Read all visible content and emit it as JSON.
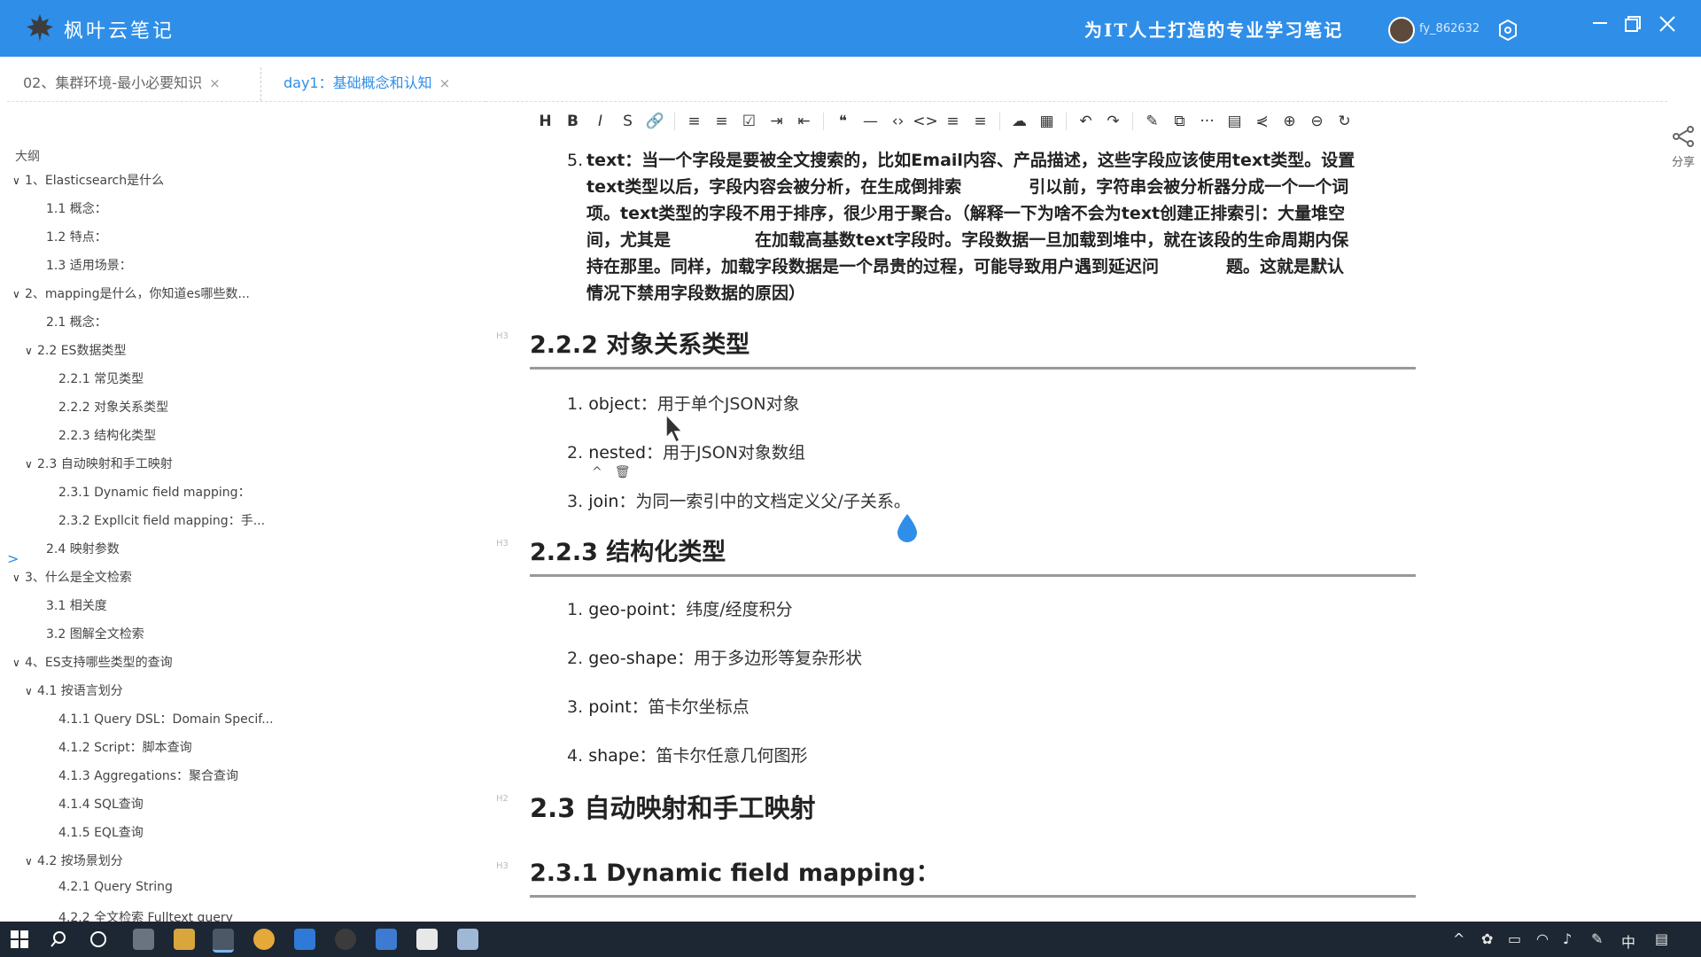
{
  "app": {
    "name": "枫叶云笔记",
    "slogan": "为IT人士打造的专业学习笔记",
    "username": "fy_862632"
  },
  "tabs": [
    {
      "label": "02、集群环境-最小必要知识",
      "close": "×"
    },
    {
      "label": "day1：基础概念和认知",
      "close": "×"
    }
  ],
  "outline": {
    "title": "大纲",
    "items": [
      {
        "label": "1、Elasticsearch是什么",
        "arrow": "∨"
      },
      {
        "label": "1.1 概念：",
        "arrow": ""
      },
      {
        "label": "1.2 特点：",
        "arrow": ""
      },
      {
        "label": "1.3 适用场景：",
        "arrow": ""
      },
      {
        "label": "2、mapping是什么，你知道es哪些数...",
        "arrow": "∨"
      },
      {
        "label": "2.1 概念：",
        "arrow": ""
      },
      {
        "label": "2.2 ES数据类型",
        "arrow": "∨"
      },
      {
        "label": "2.2.1 常见类型",
        "arrow": ""
      },
      {
        "label": "2.2.2 对象关系类型",
        "arrow": ""
      },
      {
        "label": "2.2.3 结构化类型",
        "arrow": ""
      },
      {
        "label": "2.3 自动映射和手工映射",
        "arrow": "∨"
      },
      {
        "label": "2.3.1 Dynamic field mapping：",
        "arrow": ""
      },
      {
        "label": "2.3.2 Expllcit field mapping：手...",
        "arrow": ""
      },
      {
        "label": "2.4 映射参数",
        "arrow": ""
      },
      {
        "label": "3、什么是全文检索",
        "arrow": "∨"
      },
      {
        "label": "3.1 相关度",
        "arrow": ""
      },
      {
        "label": "3.2 图解全文检索",
        "arrow": ""
      },
      {
        "label": "4、ES支持哪些类型的查询",
        "arrow": "∨"
      },
      {
        "label": "4.1 按语言划分",
        "arrow": "∨"
      },
      {
        "label": "4.1.1 Query DSL：Domain Specif...",
        "arrow": ""
      },
      {
        "label": "4.1.2 Script：脚本查询",
        "arrow": ""
      },
      {
        "label": "4.1.3 Aggregations：聚合查询",
        "arrow": ""
      },
      {
        "label": "4.1.4 SQL查询",
        "arrow": ""
      },
      {
        "label": "4.1.5 EQL查询",
        "arrow": ""
      },
      {
        "label": "4.2 按场景划分",
        "arrow": "∨"
      },
      {
        "label": "4.2.1 Query String",
        "arrow": ""
      },
      {
        "label": "4.2.2 全文检索 Fulltext query",
        "arrow": ""
      }
    ]
  },
  "toolbar": {
    "buttons": [
      "H",
      "B",
      "I",
      "S",
      "🔗",
      "≡",
      "≡",
      "☑",
      "⇥",
      "⇤",
      "❝",
      "—",
      "‹›",
      "<>",
      "≡",
      "≡",
      "☁",
      "▦",
      "↶",
      "↷",
      "✎",
      "⧉",
      "···",
      "▤",
      "⋞",
      "⊕",
      "⊖",
      "↻"
    ]
  },
  "share_label": "分享",
  "doc": {
    "para5_num": "5.",
    "para5_lines": [
      "text：当一个字段是要被全文搜索的，比如Email内容、产品描述，这些字段应该使用text类型。设置",
      "text类型以后，字段内容会被分析，在生成倒排索　　　　引以前，字符串会被分析器分成一个一个词",
      "项。text类型的字段不用于排序，很少用于聚合。（解释一下为啥不会为text创建正排索引：大量堆空",
      "间，尤其是　　　　　在加载高基数text字段时。字段数据一旦加载到堆中，就在该段的生命周期内保",
      "持在那里。同样，加载字段数据是一个昂贵的过程，可能导致用户遇到延迟问　　　　题。这就是默认",
      "情况下禁用字段数据的原因）"
    ],
    "h3_marker": "H3",
    "h2_marker": "H2",
    "sec_222": "2.2.2 对象关系类型",
    "list_222": [
      {
        "num": "1.",
        "key": "object",
        "text": "：用于单个JSON对象"
      },
      {
        "num": "2.",
        "key": "nested",
        "text": "：用于JSON对象数组"
      },
      {
        "num": "3.",
        "key": "join",
        "text": "：为同一索引中的文档定义父/子关系。"
      }
    ],
    "block_actions": "^　🗑",
    "sec_223": "2.2.3 结构化类型",
    "list_223": [
      {
        "num": "1.",
        "key": "geo-point",
        "text": "：纬度/经度积分"
      },
      {
        "num": "2.",
        "key": "geo-shape",
        "text": "：用于多边形等复杂形状"
      },
      {
        "num": "3.",
        "key": "point",
        "text": "：笛卡尔坐标点"
      },
      {
        "num": "4.",
        "key": "shape",
        "text": "：笛卡尔任意几何图形"
      }
    ],
    "sec_23": "2.3 自动映射和手工映射",
    "sec_231": "2.3.1 Dynamic field mapping："
  },
  "taskbar": {
    "ime": "中"
  },
  "colors": {
    "accent": "#2f8ee8",
    "taskbar": "#1c2733"
  }
}
